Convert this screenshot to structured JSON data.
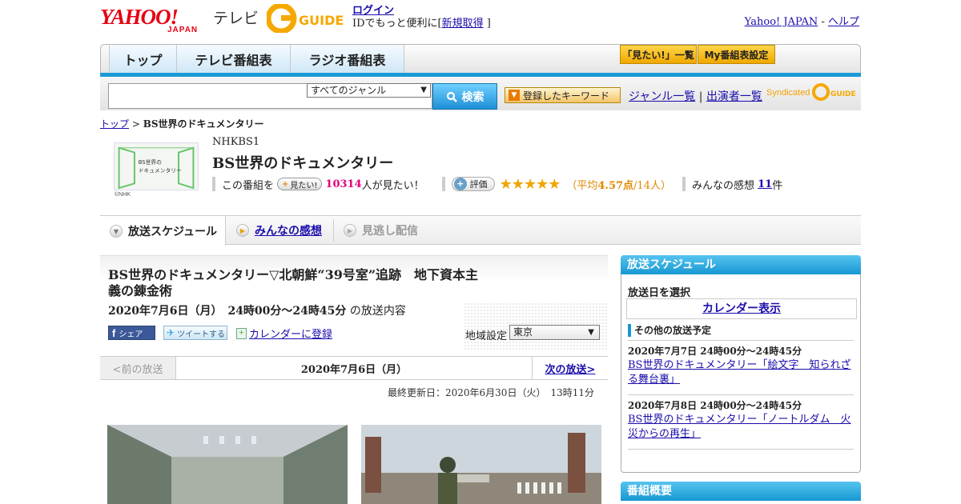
{
  "header": {
    "yahoo_logo_main": "YAHOO!",
    "yahoo_logo_sub": "JAPAN",
    "tv_label": "テレビ",
    "gguide_logo": "G-GUIDE",
    "login_link": "ログイン",
    "login_text_prefix": "IDでもっと便利に[",
    "register_link": "新規取得",
    "login_text_suffix": "]",
    "yahoo_japan_link": "Yahoo! JAPAN",
    "separator": "-",
    "help_link": "ヘルプ"
  },
  "nav": {
    "tabs": [
      "トップ",
      "テレビ番組表",
      "ラジオ番組表"
    ],
    "want_list_button": "「見たい!」一覧",
    "my_schedule_button": "My番組表設定"
  },
  "search": {
    "placeholder": "",
    "genre_selected": "すべてのジャンル",
    "search_button": "検索",
    "keyword_button": "登録したキーワード",
    "genre_list_link": "ジャンル一覧",
    "divider": "|",
    "performer_list_link": "出演者一覧",
    "syndicated_label": "Syndicated",
    "syndicated_logo": "G-GUIDE"
  },
  "breadcrumb": {
    "top": "トップ",
    "sep": ">",
    "current": "BS世界のドキュメンタリー"
  },
  "program": {
    "thumb_label": "BS世界のドキュメンタリー",
    "thumb_credit": "©NHK",
    "channel": "NHKBS1",
    "title": "BS世界のドキュメンタリー",
    "want_prefix": "この番組を",
    "want_button": "見たい!",
    "want_count": "10314",
    "want_suffix": "人が見たい！",
    "rate_button": "評価",
    "stars": "★★★★★",
    "rating_open": "（平均",
    "rating_avg": "4.57点",
    "rating_close": "/14人）",
    "reviews_prefix": "みんなの感想",
    "reviews_count": "11",
    "reviews_suffix": "件"
  },
  "tabs": {
    "schedule": "放送スケジュール",
    "reviews": "みんなの感想",
    "missed": "見逃し配信"
  },
  "episode": {
    "title": "BS世界のドキュメンタリー▽北朝鮮“39号室”追跡　地下資本主義の錬金術",
    "date": "2020年7月6日（月）　24時00分～24時45分",
    "date_suffix": "の放送内容",
    "share_fb": "シェア",
    "share_tw": "ツイートする",
    "calendar_link": "カレンダーに登録",
    "region_label": "地域設定",
    "region_value": "東京",
    "prev": "<前の放送",
    "current_date": "2020年7月6日（月）",
    "next": "次の放送>",
    "updated": "最終更新日：2020年6月30日（火）　13時11分"
  },
  "sidebar": {
    "schedule_head": "放送スケジュール",
    "select_date": "放送日を選択",
    "calendar_show": "カレンダー表示",
    "other_head": "その他の放送予定",
    "items": [
      {
        "date": "2020年7月7日  24時00分～24時45分",
        "title": "BS世界のドキュメンタリー「絵文字　知られざる舞台裏」"
      },
      {
        "date": "2020年7月8日  24時00分～24時45分",
        "title": "BS世界のドキュメンタリー「ノートルダム　火災からの再生」"
      }
    ],
    "overview_head": "番組概要"
  },
  "colors": {
    "accent_blue": "#1797d2",
    "yahoo_red": "#e60012",
    "star_gold": "#f0a500",
    "want_pink": "#e4007f"
  }
}
